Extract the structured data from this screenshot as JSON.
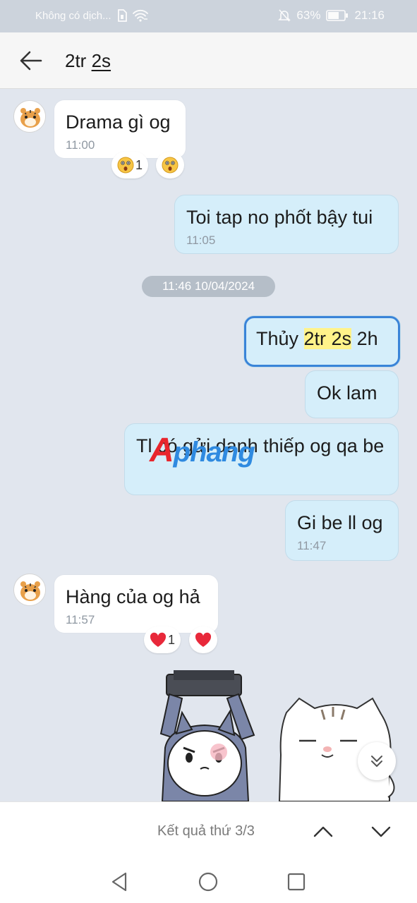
{
  "status_bar": {
    "carrier": "Không có dịch...",
    "battery": "63%",
    "time": "21:16"
  },
  "header": {
    "title_part1": "2tr",
    "title_part2": "2s"
  },
  "messages": [
    {
      "text": "Drama gì og",
      "time": "11:00",
      "reaction_count": "1"
    },
    {
      "text": "Toi tap no phốt bậy tui",
      "time": "11:05"
    },
    {
      "date_separator": "11:46 10/04/2024"
    },
    {
      "text_before": "Thủy ",
      "highlight": "2tr 2s",
      "text_after": " 2h"
    },
    {
      "text": "Ok lam"
    },
    {
      "text": "Tl có gửi danh thiếp og qa be"
    },
    {
      "text": "Gi be ll og",
      "time": "11:47"
    },
    {
      "text": "Hàng của og hả",
      "time": "11:57",
      "reaction_count": "1"
    }
  ],
  "watermark": {
    "a": "A",
    "rest": "phang"
  },
  "search": {
    "result_text": "Kết quả thứ 3/3"
  },
  "colors": {
    "background": "#e1e6ee",
    "outgoing_bubble": "#d5eefa",
    "incoming_bubble": "#ffffff",
    "highlight_border": "#3a84d8",
    "search_highlight": "#fff38a"
  },
  "icons": [
    "back-arrow-icon",
    "wifi-icon",
    "sim-icon",
    "mute-bell-icon",
    "battery-icon",
    "surprised-emoji-icon",
    "heart-icon",
    "double-chevron-down-icon",
    "chevron-up-icon",
    "chevron-down-icon",
    "back-triangle-icon",
    "home-circle-icon",
    "recents-square-icon"
  ]
}
